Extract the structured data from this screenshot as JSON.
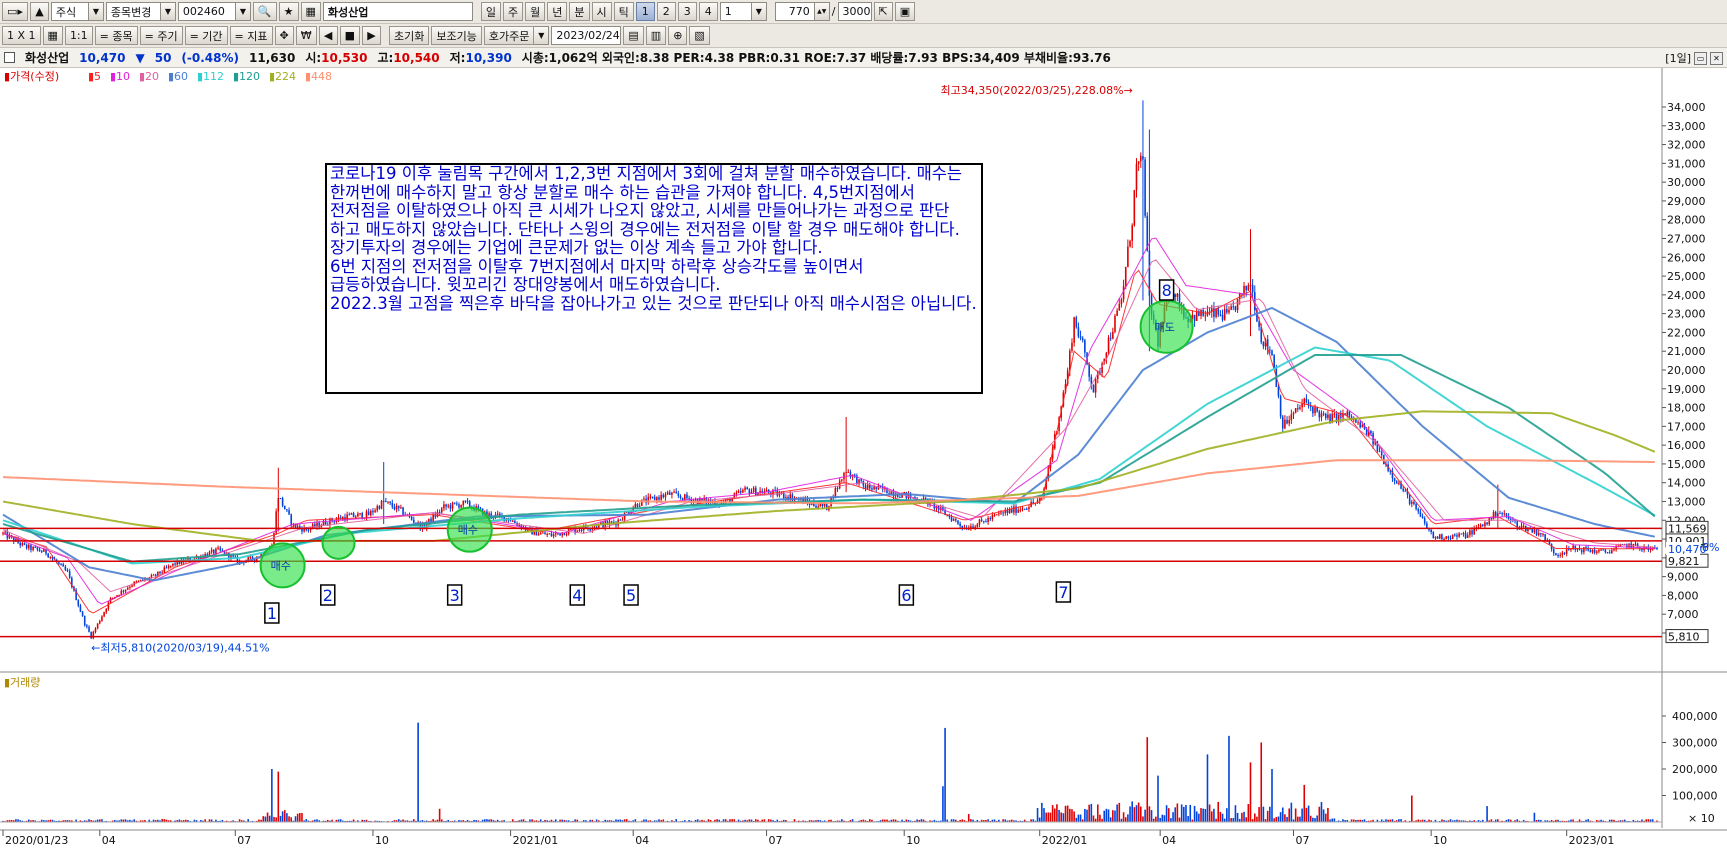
{
  "toolbar1": {
    "market": "주식",
    "change_label": "종목변경",
    "code": "002460",
    "name": "화성산업",
    "periods": [
      "일",
      "주",
      "월",
      "년",
      "분",
      "시",
      "틱"
    ],
    "numbers": [
      "1",
      "2",
      "3",
      "4"
    ],
    "period_value": "1",
    "count": "770",
    "slash": "/",
    "total": "3000"
  },
  "toolbar2": {
    "grid": "1 X 1",
    "ratio": "1:1",
    "tabs": [
      "= 종목",
      "= 주기",
      "= 기간",
      "= 지표"
    ],
    "reset": "초기화",
    "aux": "보조기능",
    "order": "호가주문",
    "date": "2023/02/24"
  },
  "info": {
    "name": "화성산업",
    "price": "10,470",
    "arrow": "▼",
    "change": "50",
    "pct": "(-0.48%)",
    "prev": "11,630",
    "open_label": "시:",
    "open": "10,530",
    "high_label": "고:",
    "high": "10,540",
    "low_label": "저:",
    "low": "10,390",
    "rest": "시총:1,062억 외국인:8.38 PER:4.38 PBR:0.31 ROE:7.37 배당률:7.93 BPS:34,409 부채비율:93.76",
    "period_tag": "[1일]"
  },
  "annotation": "코로나19 이후 눌림목 구간에서 1,2,3번 지점에서 3회에 걸쳐 분할 매수하였습니다. 매수는 한꺼번에 매수하지 말고 항상 분할로 매수 하는 습관을 가져야 합니다. 4,5번지점에서 전저점을 이탈하였으나 아직 큰 시세가 나오지 않았고, 시세를 만들어나가는 과정으로 판단 하고 매도하지 않았습니다. 단타나 스윙의 경우에는 전저점을 이탈 할 경우 매도해야 합니다. 장기투자의 경우에는 기업에 큰문제가 없는 이상 계속 들고 가야 합니다.\n6번 지점의 전저점을 이탈후 7번지점에서 마지막 하락후 상승각도를 높이면서 급등하였습니다. 윗꼬리긴 장대양봉에서 매도하였습니다.\n2022.3월 고점을 찍은후 바닥을 잡아나가고 있는 것으로 판단되나 아직 매수시점은 아닙니다.",
  "chart_data": {
    "type": "candlestick",
    "price_legend": {
      "title": "가격(수정)",
      "ma": [
        {
          "period": "5",
          "color": "#ff2020"
        },
        {
          "period": "10",
          "color": "#e020e0"
        },
        {
          "period": "20",
          "color": "#e060a0"
        },
        {
          "period": "60",
          "color": "#4a7fd0"
        },
        {
          "period": "112",
          "color": "#30d0d0"
        },
        {
          "period": "120",
          "color": "#20a090"
        },
        {
          "period": "224",
          "color": "#a0b020"
        },
        {
          "period": "448",
          "color": "#ff9070"
        }
      ]
    },
    "volume_title": "거래량",
    "volume_unit": "× 10",
    "y_ticks": [
      "34,000",
      "33,000",
      "32,000",
      "31,000",
      "30,000",
      "29,000",
      "28,000",
      "27,000",
      "26,000",
      "25,000",
      "24,000",
      "23,000",
      "22,000",
      "21,000",
      "20,000",
      "19,000",
      "18,000",
      "17,000",
      "16,000",
      "15,000",
      "14,000",
      "13,000",
      "12,000",
      "11,000",
      "10,000",
      "9,000",
      "8,000",
      "7,000",
      "6,000"
    ],
    "ylim": [
      5500,
      35000
    ],
    "vol_ticks": [
      "400,000",
      "300,000",
      "200,000",
      "100,000"
    ],
    "vol_lim": [
      0,
      460000
    ],
    "x_labels": [
      "2020/01/23",
      "04",
      "07",
      "10",
      "2021/01",
      "04",
      "07",
      "10",
      "2022/01",
      "04",
      "07",
      "10",
      "2023/01"
    ],
    "x_label_idx": [
      0,
      45,
      108,
      172,
      236,
      293,
      355,
      419,
      482,
      538,
      600,
      664,
      727
    ],
    "n_days": 770,
    "close_path": [
      [
        0,
        11300
      ],
      [
        10,
        10600
      ],
      [
        20,
        10300
      ],
      [
        30,
        9200
      ],
      [
        38,
        6500
      ],
      [
        41,
        5810
      ],
      [
        50,
        7800
      ],
      [
        60,
        8600
      ],
      [
        70,
        9000
      ],
      [
        80,
        9700
      ],
      [
        90,
        10000
      ],
      [
        100,
        10400
      ],
      [
        110,
        9800
      ],
      [
        118,
        10000
      ],
      [
        125,
        10600
      ],
      [
        128,
        13300
      ],
      [
        135,
        11700
      ],
      [
        141,
        11500
      ],
      [
        150,
        11900
      ],
      [
        160,
        12200
      ],
      [
        170,
        12300
      ],
      [
        177,
        13000
      ],
      [
        185,
        12500
      ],
      [
        195,
        11600
      ],
      [
        205,
        12700
      ],
      [
        215,
        12900
      ],
      [
        225,
        12300
      ],
      [
        235,
        12100
      ],
      [
        245,
        11400
      ],
      [
        255,
        11200
      ],
      [
        265,
        11500
      ],
      [
        275,
        11700
      ],
      [
        285,
        11900
      ],
      [
        295,
        12900
      ],
      [
        310,
        13400
      ],
      [
        320,
        13100
      ],
      [
        335,
        12900
      ],
      [
        345,
        13600
      ],
      [
        355,
        13500
      ],
      [
        365,
        13300
      ],
      [
        375,
        12900
      ],
      [
        383,
        12700
      ],
      [
        392,
        14700
      ],
      [
        400,
        13800
      ],
      [
        410,
        13600
      ],
      [
        420,
        13300
      ],
      [
        430,
        13000
      ],
      [
        440,
        12200
      ],
      [
        447,
        11600
      ],
      [
        455,
        11900
      ],
      [
        465,
        12400
      ],
      [
        475,
        12700
      ],
      [
        483,
        13100
      ],
      [
        490,
        17000
      ],
      [
        495,
        19900
      ],
      [
        498,
        22700
      ],
      [
        502,
        21300
      ],
      [
        507,
        18900
      ],
      [
        513,
        21200
      ],
      [
        520,
        23700
      ],
      [
        525,
        28000
      ],
      [
        527,
        30800
      ],
      [
        530,
        31000
      ],
      [
        533,
        23600
      ],
      [
        537,
        21500
      ],
      [
        543,
        24600
      ],
      [
        550,
        22800
      ],
      [
        560,
        23000
      ],
      [
        570,
        22900
      ],
      [
        580,
        24700
      ],
      [
        585,
        21700
      ],
      [
        590,
        20900
      ],
      [
        595,
        17000
      ],
      [
        605,
        18300
      ],
      [
        615,
        17400
      ],
      [
        625,
        17600
      ],
      [
        635,
        16600
      ],
      [
        645,
        14600
      ],
      [
        655,
        12900
      ],
      [
        665,
        11100
      ],
      [
        680,
        11200
      ],
      [
        690,
        11900
      ],
      [
        695,
        12500
      ],
      [
        705,
        11700
      ],
      [
        715,
        11300
      ],
      [
        722,
        10200
      ],
      [
        730,
        10500
      ],
      [
        745,
        10300
      ],
      [
        755,
        10700
      ],
      [
        765,
        10470
      ],
      [
        769,
        10470
      ]
    ],
    "special_candles": [
      {
        "day": 128,
        "low": 11400,
        "high": 14800
      },
      {
        "day": 177,
        "low": 11800,
        "high": 15100
      },
      {
        "day": 392,
        "low": 13500,
        "high": 17500
      },
      {
        "day": 530,
        "low": 23700,
        "high": 34350
      },
      {
        "day": 533,
        "low": 21000,
        "high": 32800
      },
      {
        "day": 580,
        "low": 21800,
        "high": 27500
      },
      {
        "day": 695,
        "low": 11600,
        "high": 13900
      }
    ],
    "ma_paths": {
      "5": [
        [
          0,
          11300
        ],
        [
          20,
          10600
        ],
        [
          41,
          7000
        ],
        [
          80,
          9500
        ],
        [
          128,
          11300
        ],
        [
          141,
          12000
        ],
        [
          200,
          12300
        ],
        [
          250,
          11400
        ],
        [
          300,
          12500
        ],
        [
          355,
          13400
        ],
        [
          392,
          14000
        ],
        [
          447,
          12000
        ],
        [
          483,
          13000
        ],
        [
          498,
          21000
        ],
        [
          513,
          19500
        ],
        [
          527,
          25500
        ],
        [
          537,
          23500
        ],
        [
          560,
          23000
        ],
        [
          580,
          24200
        ],
        [
          595,
          18500
        ],
        [
          625,
          17600
        ],
        [
          665,
          11800
        ],
        [
          695,
          12200
        ],
        [
          722,
          10500
        ],
        [
          769,
          10480
        ]
      ],
      "10": [
        [
          0,
          11300
        ],
        [
          30,
          10000
        ],
        [
          45,
          7500
        ],
        [
          90,
          9800
        ],
        [
          135,
          11800
        ],
        [
          200,
          12400
        ],
        [
          260,
          11300
        ],
        [
          310,
          13000
        ],
        [
          355,
          13500
        ],
        [
          395,
          14400
        ],
        [
          450,
          12000
        ],
        [
          490,
          15200
        ],
        [
          505,
          21000
        ],
        [
          525,
          25000
        ],
        [
          535,
          27200
        ],
        [
          550,
          24500
        ],
        [
          580,
          24000
        ],
        [
          600,
          20000
        ],
        [
          630,
          17500
        ],
        [
          665,
          12000
        ],
        [
          700,
          12200
        ],
        [
          730,
          10700
        ],
        [
          769,
          10500
        ]
      ],
      "20": [
        [
          0,
          11500
        ],
        [
          35,
          9800
        ],
        [
          50,
          8200
        ],
        [
          100,
          10100
        ],
        [
          140,
          11600
        ],
        [
          200,
          12400
        ],
        [
          270,
          11300
        ],
        [
          320,
          13000
        ],
        [
          360,
          13400
        ],
        [
          400,
          14000
        ],
        [
          455,
          12100
        ],
        [
          495,
          17000
        ],
        [
          515,
          21000
        ],
        [
          535,
          26000
        ],
        [
          555,
          23200
        ],
        [
          585,
          23800
        ],
        [
          605,
          19000
        ],
        [
          640,
          16000
        ],
        [
          670,
          12000
        ],
        [
          705,
          12000
        ],
        [
          740,
          10800
        ],
        [
          769,
          10550
        ]
      ],
      "60": [
        [
          0,
          12300
        ],
        [
          40,
          9500
        ],
        [
          70,
          8800
        ],
        [
          110,
          9700
        ],
        [
          150,
          11200
        ],
        [
          220,
          12200
        ],
        [
          300,
          12300
        ],
        [
          360,
          13100
        ],
        [
          420,
          13400
        ],
        [
          470,
          12900
        ],
        [
          500,
          15500
        ],
        [
          530,
          20000
        ],
        [
          560,
          22000
        ],
        [
          590,
          23300
        ],
        [
          620,
          21500
        ],
        [
          660,
          17000
        ],
        [
          700,
          13200
        ],
        [
          740,
          11800
        ],
        [
          769,
          11100
        ]
      ],
      "112": [
        [
          0,
          12000
        ],
        [
          60,
          9700
        ],
        [
          110,
          10000
        ],
        [
          160,
          11300
        ],
        [
          240,
          12100
        ],
        [
          320,
          12700
        ],
        [
          400,
          13100
        ],
        [
          470,
          12900
        ],
        [
          510,
          14200
        ],
        [
          560,
          18200
        ],
        [
          610,
          21200
        ],
        [
          645,
          20500
        ],
        [
          690,
          17000
        ],
        [
          740,
          14000
        ],
        [
          769,
          12200
        ]
      ],
      "120": [
        [
          0,
          11800
        ],
        [
          60,
          9800
        ],
        [
          110,
          10200
        ],
        [
          170,
          11500
        ],
        [
          240,
          12300
        ],
        [
          320,
          12800
        ],
        [
          400,
          13100
        ],
        [
          470,
          13000
        ],
        [
          510,
          14000
        ],
        [
          560,
          17500
        ],
        [
          610,
          20800
        ],
        [
          650,
          20800
        ],
        [
          700,
          18000
        ],
        [
          745,
          14500
        ],
        [
          769,
          12100
        ]
      ],
      "224": [
        [
          0,
          13000
        ],
        [
          60,
          11800
        ],
        [
          120,
          10900
        ],
        [
          200,
          10900
        ],
        [
          280,
          11800
        ],
        [
          360,
          12500
        ],
        [
          440,
          13000
        ],
        [
          500,
          13700
        ],
        [
          560,
          15800
        ],
        [
          620,
          17300
        ],
        [
          660,
          17800
        ],
        [
          720,
          17700
        ],
        [
          750,
          16500
        ],
        [
          769,
          15600
        ]
      ],
      "448": [
        [
          0,
          14300
        ],
        [
          100,
          13800
        ],
        [
          200,
          13400
        ],
        [
          300,
          13000
        ],
        [
          400,
          12900
        ],
        [
          500,
          13300
        ],
        [
          560,
          14500
        ],
        [
          620,
          15200
        ],
        [
          700,
          15200
        ],
        [
          769,
          15100
        ]
      ]
    },
    "hlines": [
      {
        "value": 11569,
        "label": "11,569"
      },
      {
        "value": 10901,
        "label": "10,901"
      },
      {
        "value": 9821,
        "label": "9,821"
      },
      {
        "value": 5810,
        "label": "5,810"
      }
    ],
    "last_price": "10,470",
    "partial_label": "8%",
    "max_annotation": "최고34,350(2022/03/25),228.08%→",
    "min_annotation": "←최저5,810(2020/03/19),44.51%",
    "markers": [
      {
        "num": "1",
        "day": 125
      },
      {
        "num": "2",
        "day": 151
      },
      {
        "num": "3",
        "day": 210
      },
      {
        "num": "4",
        "day": 267
      },
      {
        "num": "5",
        "day": 292
      },
      {
        "num": "6",
        "day": 420
      },
      {
        "num": "7",
        "day": 493
      },
      {
        "num": "8",
        "day": 541
      }
    ],
    "circles": [
      {
        "day": 130,
        "value": 9600,
        "label": "매수"
      },
      {
        "day": 156,
        "value": 10800,
        "label": ""
      },
      {
        "day": 217,
        "value": 11500,
        "label": "매수"
      },
      {
        "day": 541,
        "value": 22300,
        "label": "매도"
      }
    ],
    "volume_spikes": [
      [
        125,
        200000
      ],
      [
        128,
        190000
      ],
      [
        193,
        375000
      ],
      [
        203,
        50000
      ],
      [
        437,
        135000
      ],
      [
        438,
        355000
      ],
      [
        449,
        30000
      ],
      [
        532,
        320000
      ],
      [
        537,
        175000
      ],
      [
        546,
        70000
      ],
      [
        560,
        255000
      ],
      [
        570,
        325000
      ],
      [
        580,
        225000
      ],
      [
        585,
        300000
      ],
      [
        590,
        200000
      ],
      [
        605,
        140000
      ],
      [
        655,
        100000
      ],
      [
        690,
        60000
      ],
      [
        712,
        35000
      ]
    ]
  }
}
